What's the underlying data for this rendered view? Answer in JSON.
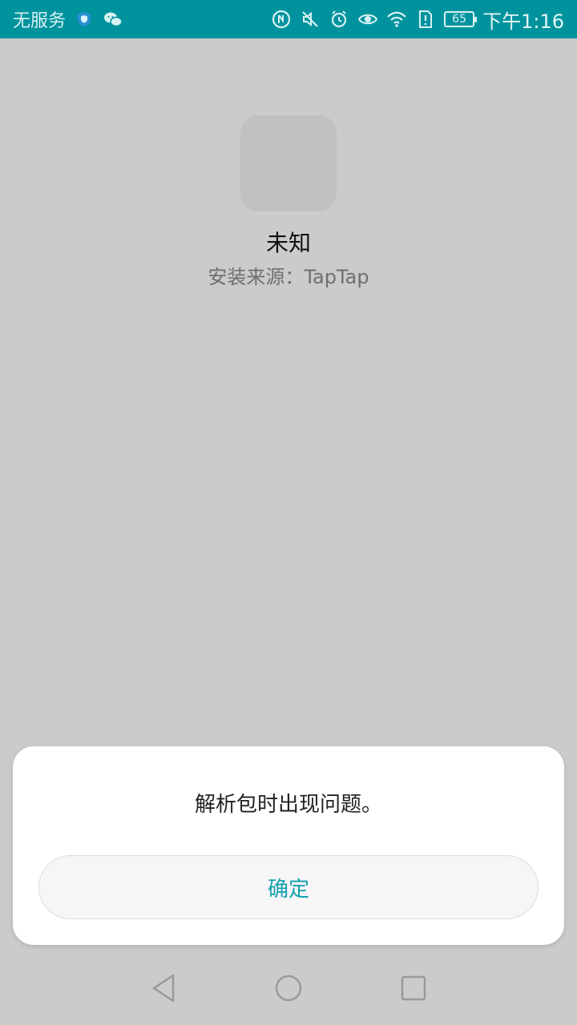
{
  "status_bar": {
    "carrier": "无服务",
    "time": "下午1:16",
    "battery": "65",
    "icons": [
      "shield-icon",
      "wechat-icon",
      "nfc-icon",
      "mute-icon",
      "alarm-icon",
      "eye-icon",
      "wifi-icon",
      "sim-alert-icon",
      "battery-icon"
    ]
  },
  "app": {
    "name": "未知",
    "source": "安装来源：TapTap"
  },
  "dialog": {
    "message": "解析包时出现问题。",
    "confirm_label": "确定"
  },
  "navigation": {
    "buttons": [
      "back-icon",
      "home-icon",
      "recents-icon"
    ]
  },
  "colors": {
    "status_bar_bg": "#00939e",
    "background": "#cbcbcb",
    "accent": "#13a0ad"
  }
}
